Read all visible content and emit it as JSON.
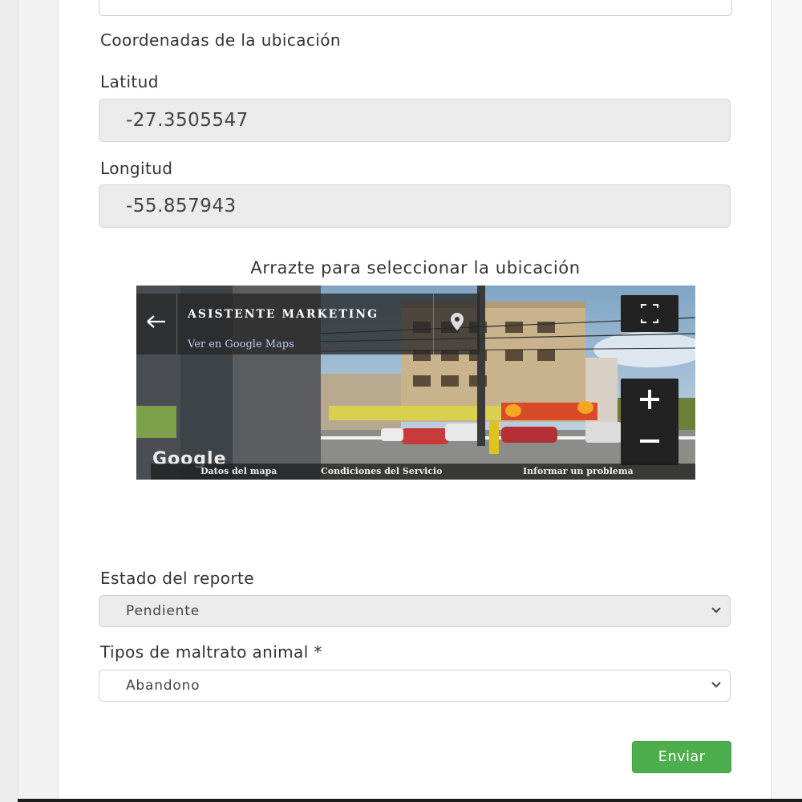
{
  "form": {
    "coords_heading": "Coordenadas de la ubicación",
    "latitude_label": "Latitud",
    "latitude_value": "-27.3505547",
    "longitude_label": "Longitud",
    "longitude_value": "-55.857943",
    "map_caption": "Arrazte para seleccionar la ubicación",
    "status_label": "Estado del reporte",
    "status_value": "Pendiente",
    "abuse_label": "Tipos de maltrato animal *",
    "abuse_value": "Abandono",
    "submit_label": "Enviar"
  },
  "streetview": {
    "place_name": "ASISTENTE MARKETING",
    "maps_link": "Ver en Google Maps",
    "google_logo": "Google",
    "footer": {
      "map_data": "Datos del mapa",
      "terms": "Condiciones del Servicio",
      "report": "Informar un problema"
    },
    "icons": [
      "back-arrow-icon",
      "location-pin-icon",
      "fullscreen-icon",
      "zoom-in-icon",
      "zoom-out-icon"
    ]
  },
  "colors": {
    "submit_bg": "#4cae4c",
    "readonly_bg": "#ebebeb"
  }
}
